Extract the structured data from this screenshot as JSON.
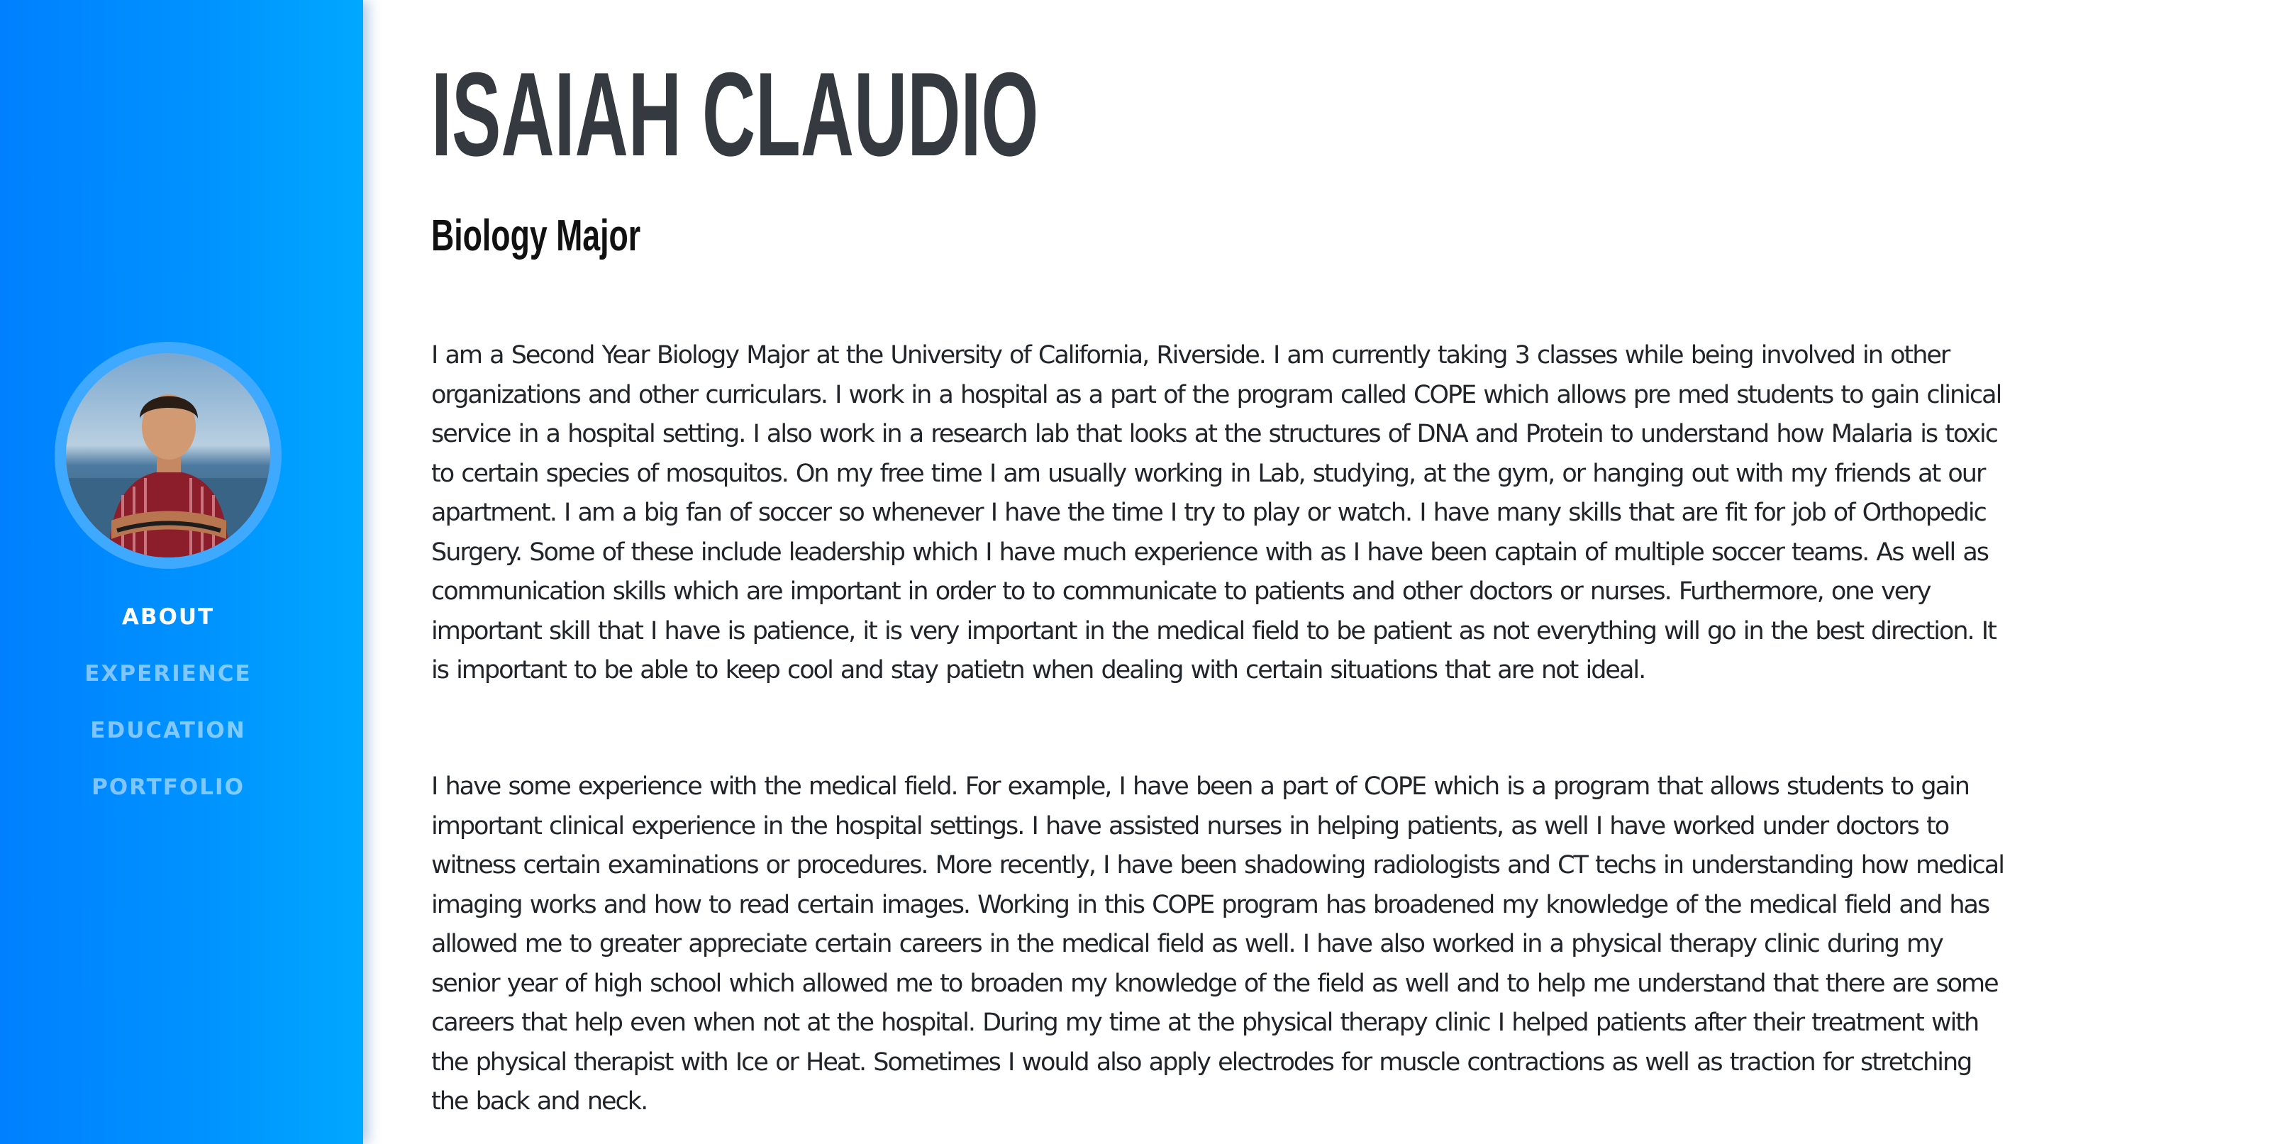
{
  "sidebar": {
    "avatar_alt": "Profile photo",
    "nav": [
      {
        "label": "ABOUT"
      },
      {
        "label": "EXPERIENCE"
      },
      {
        "label": "EDUCATION"
      },
      {
        "label": "PORTFOLIO"
      }
    ],
    "active_item": "ABOUT"
  },
  "main": {
    "name": "ISAIAH CLAUDIO",
    "subtitle": "Biology Major",
    "paragraphs": [
      "I am a Second Year Biology Major at the University of California, Riverside. I am currently taking 3 classes while being involved in other organizations and other curriculars. I work in a hospital as a part of the program called COPE which allows pre med students to gain clinical service in a hospital setting. I also work in a research lab that looks at the structures of DNA and Protein to understand how Malaria is toxic to certain species of mosquitos. On my free time I am usually working in Lab, studying, at the gym, or hanging out with my friends at our apartment. I am a big fan of soccer so whenever I have the time I try to play or watch. I have many skills that are fit for job of Orthopedic Surgery. Some of these include leadership which I have much experience with as I have been captain of multiple soccer teams. As well as communication skills which are important in order to to communicate to patients and other doctors or nurses. Furthermore, one very important skill that I have is patience, it is very important in the medical field to be patient as not everything will go in the best direction. It is important to be able to keep cool and stay patietn when dealing with certain situations that are not ideal.",
      "I have some experience with the medical field. For example, I have been a part of COPE which is a program that allows students to gain important clinical experience in the hospital settings. I have assisted nurses in helping patients, as well I have worked under doctors to witness certain examinations or procedures. More recently, I have been shadowing radiologists and CT techs in understanding how medical imaging works and how to read certain images. Working in this COPE program has broadened my knowledge of the medical field and has allowed me to greater appreciate certain careers in the medical field as well. I have also worked in a physical therapy clinic during my senior year of high school which allowed me to broaden my knowledge of the field as well and to help me understand that there are some careers that help even when not at the hospital. During my time at the physical therapy clinic I helped patients after their treatment with the physical therapist with Ice or Heat. Sometimes I would also apply electrodes for muscle contractions as well as traction for stretching the back and neck."
    ]
  },
  "colors": {
    "sidebar_start": "#0080ff",
    "sidebar_end": "#00a8ff",
    "name_color": "#343a40",
    "body_text": "#212529",
    "nav_active": "#ffffff",
    "nav_inactive": "#7fc4ff"
  }
}
